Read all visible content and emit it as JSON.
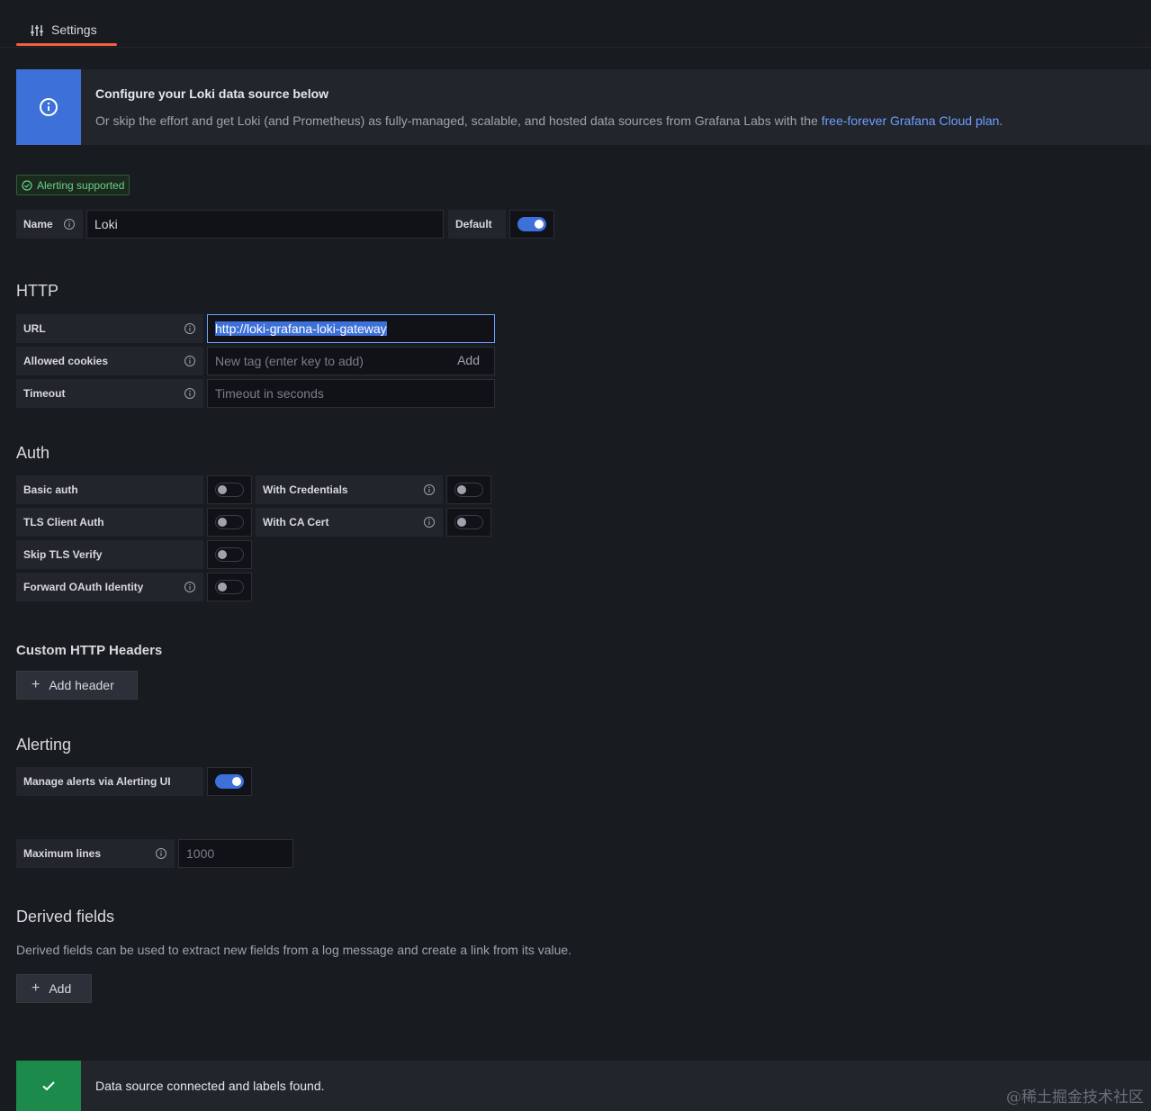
{
  "tabs": {
    "settings_label": "Settings"
  },
  "info_banner": {
    "title": "Configure your Loki data source below",
    "text": "Or skip the effort and get Loki (and Prometheus) as fully-managed, scalable, and hosted data sources from Grafana Labs with the ",
    "link": "free-forever Grafana Cloud plan",
    "suffix": "."
  },
  "badge": {
    "label": "Alerting supported"
  },
  "name_row": {
    "label": "Name",
    "value": "Loki",
    "default_label": "Default",
    "default_on": true
  },
  "http": {
    "title": "HTTP",
    "url_label": "URL",
    "url_value": "http://loki-grafana-loki-gateway",
    "cookies_label": "Allowed cookies",
    "cookies_placeholder": "New tag (enter key to add)",
    "cookies_add": "Add",
    "timeout_label": "Timeout",
    "timeout_placeholder": "Timeout in seconds"
  },
  "auth": {
    "title": "Auth",
    "basic_auth": "Basic auth",
    "tls_client_auth": "TLS Client Auth",
    "skip_tls_verify": "Skip TLS Verify",
    "forward_oauth": "Forward OAuth Identity",
    "with_credentials": "With Credentials",
    "with_ca_cert": "With CA Cert"
  },
  "headers": {
    "title": "Custom HTTP Headers",
    "add_label": "Add header"
  },
  "alerting": {
    "title": "Alerting",
    "manage_label": "Manage alerts via Alerting UI",
    "manage_on": true
  },
  "max_lines": {
    "label": "Maximum lines",
    "placeholder": "1000"
  },
  "derived": {
    "title": "Derived fields",
    "description": "Derived fields can be used to extract new fields from a log message and create a link from its value.",
    "add_label": "Add"
  },
  "status": {
    "message": "Data source connected and labels found."
  },
  "watermark": "@稀土掘金技术社区",
  "colors": {
    "accent": "#3d71d9",
    "tab_underline": "#f55f3e",
    "success": "#1b8a4a",
    "link": "#6e9fff"
  }
}
